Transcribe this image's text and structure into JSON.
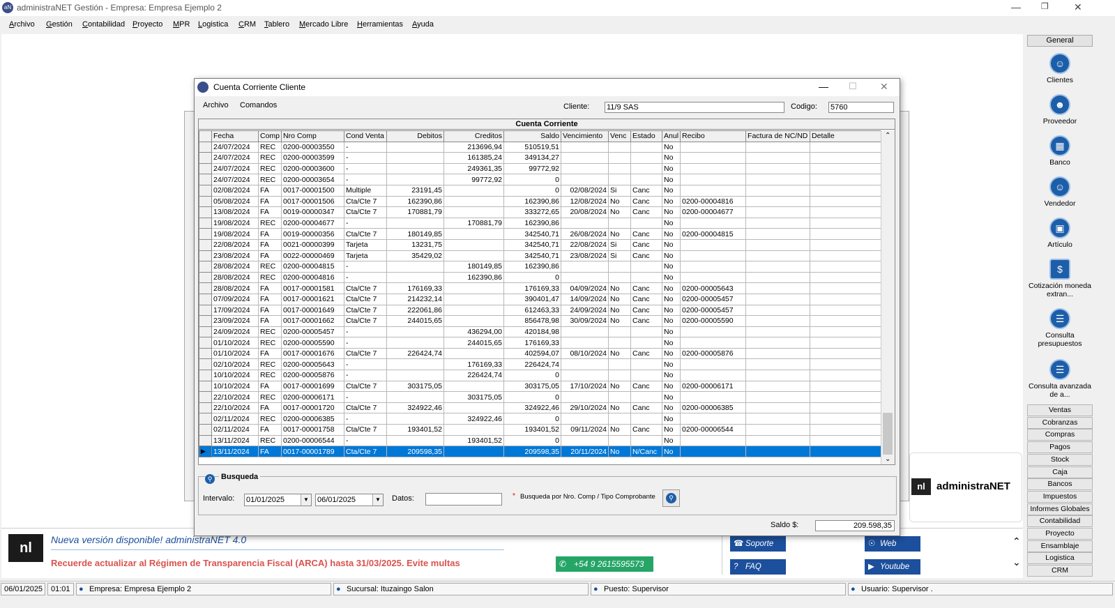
{
  "app": {
    "title": "administraNET Gestión - Empresa: Empresa Ejemplo 2"
  },
  "menu": [
    "Archivo",
    "Gestión",
    "Contabilidad",
    "Proyecto",
    "MPR",
    "Logistica",
    "CRM",
    "Tablero",
    "Mercado Libre",
    "Herramientas",
    "Ayuda"
  ],
  "dialog": {
    "title": "Cuenta Corriente Cliente",
    "menu": [
      "Archivo",
      "Comandos"
    ],
    "cliente_label": "Cliente:",
    "cliente_value": "11/9 SAS",
    "codigo_label": "Codigo:",
    "codigo_value": "5760",
    "grid_caption": "Cuenta Corriente",
    "columns": [
      "Fecha",
      "Comp",
      "Nro Comp",
      "Cond Venta",
      "Debitos",
      "Creditos",
      "Saldo",
      "Vencimiento",
      "Venc",
      "Estado",
      "Anul",
      "Recibo",
      "Factura de NC/ND",
      "Detalle"
    ],
    "rows": [
      [
        "24/07/2024",
        "REC",
        "0200-00003550",
        "-",
        "",
        "213696,94",
        "510519,51",
        "",
        "",
        "",
        "No",
        "",
        "",
        ""
      ],
      [
        "24/07/2024",
        "REC",
        "0200-00003599",
        "-",
        "",
        "161385,24",
        "349134,27",
        "",
        "",
        "",
        "No",
        "",
        "",
        ""
      ],
      [
        "24/07/2024",
        "REC",
        "0200-00003600",
        "-",
        "",
        "249361,35",
        "99772,92",
        "",
        "",
        "",
        "No",
        "",
        "",
        ""
      ],
      [
        "24/07/2024",
        "REC",
        "0200-00003654",
        "-",
        "",
        "99772,92",
        "0",
        "",
        "",
        "",
        "No",
        "",
        "",
        ""
      ],
      [
        "02/08/2024",
        "FA",
        "0017-00001500",
        "Multiple",
        "23191,45",
        "",
        "0",
        "02/08/2024",
        "Si",
        "Canc",
        "No",
        "",
        "",
        ""
      ],
      [
        "05/08/2024",
        "FA",
        "0017-00001506",
        "Cta/Cte 7",
        "162390,86",
        "",
        "162390,86",
        "12/08/2024",
        "No",
        "Canc",
        "No",
        "0200-00004816",
        "",
        ""
      ],
      [
        "13/08/2024",
        "FA",
        "0019-00000347",
        "Cta/Cte 7",
        "170881,79",
        "",
        "333272,65",
        "20/08/2024",
        "No",
        "Canc",
        "No",
        "0200-00004677",
        "",
        ""
      ],
      [
        "19/08/2024",
        "REC",
        "0200-00004677",
        "-",
        "",
        "170881,79",
        "162390,86",
        "",
        "",
        "",
        "No",
        "",
        "",
        ""
      ],
      [
        "19/08/2024",
        "FA",
        "0019-00000356",
        "Cta/Cte 7",
        "180149,85",
        "",
        "342540,71",
        "26/08/2024",
        "No",
        "Canc",
        "No",
        "0200-00004815",
        "",
        ""
      ],
      [
        "22/08/2024",
        "FA",
        "0021-00000399",
        "Tarjeta",
        "13231,75",
        "",
        "342540,71",
        "22/08/2024",
        "Si",
        "Canc",
        "No",
        "",
        "",
        ""
      ],
      [
        "23/08/2024",
        "FA",
        "0022-00000469",
        "Tarjeta",
        "35429,02",
        "",
        "342540,71",
        "23/08/2024",
        "Si",
        "Canc",
        "No",
        "",
        "",
        ""
      ],
      [
        "28/08/2024",
        "REC",
        "0200-00004815",
        "-",
        "",
        "180149,85",
        "162390,86",
        "",
        "",
        "",
        "No",
        "",
        "",
        ""
      ],
      [
        "28/08/2024",
        "REC",
        "0200-00004816",
        "-",
        "",
        "162390,86",
        "0",
        "",
        "",
        "",
        "No",
        "",
        "",
        ""
      ],
      [
        "28/08/2024",
        "FA",
        "0017-00001581",
        "Cta/Cte 7",
        "176169,33",
        "",
        "176169,33",
        "04/09/2024",
        "No",
        "Canc",
        "No",
        "0200-00005643",
        "",
        ""
      ],
      [
        "07/09/2024",
        "FA",
        "0017-00001621",
        "Cta/Cte 7",
        "214232,14",
        "",
        "390401,47",
        "14/09/2024",
        "No",
        "Canc",
        "No",
        "0200-00005457",
        "",
        ""
      ],
      [
        "17/09/2024",
        "FA",
        "0017-00001649",
        "Cta/Cte 7",
        "222061,86",
        "",
        "612463,33",
        "24/09/2024",
        "No",
        "Canc",
        "No",
        "0200-00005457",
        "",
        ""
      ],
      [
        "23/09/2024",
        "FA",
        "0017-00001662",
        "Cta/Cte 7",
        "244015,65",
        "",
        "856478,98",
        "30/09/2024",
        "No",
        "Canc",
        "No",
        "0200-00005590",
        "",
        ""
      ],
      [
        "24/09/2024",
        "REC",
        "0200-00005457",
        "-",
        "",
        "436294,00",
        "420184,98",
        "",
        "",
        "",
        "No",
        "",
        "",
        ""
      ],
      [
        "01/10/2024",
        "REC",
        "0200-00005590",
        "-",
        "",
        "244015,65",
        "176169,33",
        "",
        "",
        "",
        "No",
        "",
        "",
        ""
      ],
      [
        "01/10/2024",
        "FA",
        "0017-00001676",
        "Cta/Cte 7",
        "226424,74",
        "",
        "402594,07",
        "08/10/2024",
        "No",
        "Canc",
        "No",
        "0200-00005876",
        "",
        ""
      ],
      [
        "02/10/2024",
        "REC",
        "0200-00005643",
        "-",
        "",
        "176169,33",
        "226424,74",
        "",
        "",
        "",
        "No",
        "",
        "",
        ""
      ],
      [
        "10/10/2024",
        "REC",
        "0200-00005876",
        "-",
        "",
        "226424,74",
        "0",
        "",
        "",
        "",
        "No",
        "",
        "",
        ""
      ],
      [
        "10/10/2024",
        "FA",
        "0017-00001699",
        "Cta/Cte 7",
        "303175,05",
        "",
        "303175,05",
        "17/10/2024",
        "No",
        "Canc",
        "No",
        "0200-00006171",
        "",
        ""
      ],
      [
        "22/10/2024",
        "REC",
        "0200-00006171",
        "-",
        "",
        "303175,05",
        "0",
        "",
        "",
        "",
        "No",
        "",
        "",
        ""
      ],
      [
        "22/10/2024",
        "FA",
        "0017-00001720",
        "Cta/Cte 7",
        "324922,46",
        "",
        "324922,46",
        "29/10/2024",
        "No",
        "Canc",
        "No",
        "0200-00006385",
        "",
        ""
      ],
      [
        "02/11/2024",
        "REC",
        "0200-00006385",
        "-",
        "",
        "324922,46",
        "0",
        "",
        "",
        "",
        "No",
        "",
        "",
        ""
      ],
      [
        "02/11/2024",
        "FA",
        "0017-00001758",
        "Cta/Cte 7",
        "193401,52",
        "",
        "193401,52",
        "09/11/2024",
        "No",
        "Canc",
        "No",
        "0200-00006544",
        "",
        ""
      ],
      [
        "13/11/2024",
        "REC",
        "0200-00006544",
        "-",
        "",
        "193401,52",
        "0",
        "",
        "",
        "",
        "No",
        "",
        "",
        ""
      ],
      [
        "13/11/2024",
        "FA",
        "0017-00001789",
        "Cta/Cte 7",
        "209598,35",
        "",
        "209598,35",
        "20/11/2024",
        "No",
        "N/Canc",
        "No",
        "",
        "",
        ""
      ]
    ],
    "selected_row": 28,
    "busqueda": {
      "title": "Busqueda",
      "intervalo_label": "Intervalo:",
      "desde": "01/01/2025",
      "hasta": "06/01/2025",
      "datos_label": "Datos:",
      "datos_value": "",
      "hint": "Busqueda por Nro. Comp / Tipo Comprobante"
    },
    "saldo_label": "Saldo $:",
    "saldo_value": "209.598,35"
  },
  "right_panel": {
    "header": "General",
    "items": [
      "Clientes",
      "Proveedor",
      "Banco",
      "Vendedor",
      "Artículo",
      "Cotización moneda extran...",
      "Consulta presupuestos",
      "Consulta avanzada de a..."
    ],
    "buttons": [
      "Ventas",
      "Cobranzas",
      "Compras",
      "Pagos",
      "Stock",
      "Caja",
      "Bancos",
      "Impuestos",
      "Informes Globales",
      "Contabilidad",
      "Proyecto",
      "Ensamblaje",
      "Logistica",
      "CRM"
    ]
  },
  "banner": {
    "headline": "Nueva versión disponible! administraNET 4.0",
    "notice": "Recuerde actualizar al Régimen de Transparencia Fiscal (ARCA) hasta 31/03/2025. Evite multas",
    "whatsapp": "+54 9 2615595573",
    "links": [
      "Soporte",
      "Web",
      "FAQ",
      "Youtube"
    ],
    "brand": "administraNET"
  },
  "status": {
    "date": "06/01/2025",
    "time": "01:01",
    "empresa": "Empresa: Empresa Ejemplo 2",
    "sucursal": "Sucursal: Ituzaingo Salon",
    "puesto": "Puesto: Supervisor",
    "usuario": "Usuario: Supervisor ."
  }
}
